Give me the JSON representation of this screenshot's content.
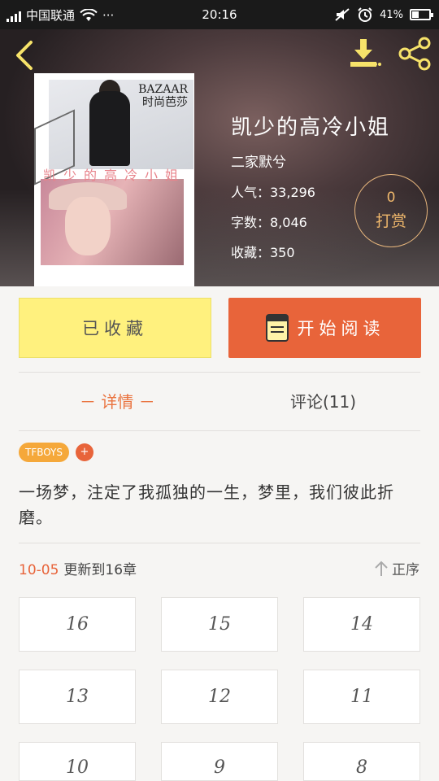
{
  "status_bar": {
    "carrier": "中国联通",
    "more": "···",
    "time": "20:16",
    "battery": "41%",
    "battery_level": 0.41
  },
  "header": {
    "back_icon": "chevron-left-icon",
    "download_icon": "download-icon",
    "share_icon": "share-icon",
    "accent": "#f7e36a"
  },
  "cover": {
    "brand_line1": "BAZAAR",
    "brand_line2": "时尚芭莎",
    "title": "凯少的高冷小姐"
  },
  "book": {
    "title": "凯少的高冷小姐",
    "author": "二家默兮",
    "popularity": "人气：33,296",
    "word_count": "字数：8,046",
    "favorites": "收藏：350"
  },
  "reward": {
    "count": "0",
    "label": "打赏"
  },
  "actions": {
    "collected_label": "已收藏",
    "read_label": "开始阅读",
    "collected_color": "#fff17e",
    "read_color": "#e8643a"
  },
  "tabs": {
    "detail": "－ 详情 －",
    "comments": "评论(11)"
  },
  "tags": {
    "items": [
      "TFBOYS"
    ],
    "add": "+"
  },
  "description": "一场梦，注定了我孤独的一生，梦里，我们彼此折磨。",
  "update": {
    "date": "10-05",
    "text": "更新到16章",
    "order_label": "正序",
    "order_icon": "arrow-up-icon"
  },
  "chapters": [
    "16",
    "15",
    "14",
    "13",
    "12",
    "11",
    "10",
    "9",
    "8"
  ]
}
